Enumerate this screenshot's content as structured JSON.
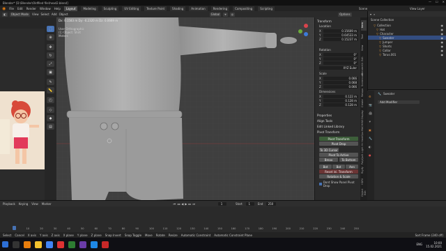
{
  "titlebar": {
    "title": "Blender* [D:\\Blender\\Oldfiled file\\head2.blend]"
  },
  "menu": {
    "items": [
      "File",
      "Edit",
      "Render",
      "Window",
      "Help"
    ]
  },
  "workspaces": {
    "tabs": [
      "Layout",
      "Modeling",
      "Sculpting",
      "UV Editing",
      "Texture Paint",
      "Shading",
      "Animation",
      "Rendering",
      "Compositing",
      "Scripting"
    ],
    "active": "Layout"
  },
  "scene": {
    "scene_label": "Scene",
    "view_layer_label": "View Layer"
  },
  "viewport_header": {
    "mode": "Object Mode",
    "view": "View",
    "select": "Select",
    "add": "Add",
    "object": "Object",
    "orientation": "Global",
    "options": "Options"
  },
  "viewport": {
    "stats": "Dx: 0.1583 m  Dy: -0.2320 m  Dz: 0.0669 m",
    "mode_line1": "User Orthographic",
    "mode_line2": "(1) Object: Shirt",
    "mode_line3": "Meters"
  },
  "npanel": {
    "transform": "Transform",
    "location": "Location",
    "loc": [
      {
        "axis": "X",
        "val": "0.15609 m"
      },
      {
        "axis": "Y",
        "val": "0.64533 m"
      },
      {
        "axis": "Z",
        "val": "0.15237 m"
      }
    ],
    "rotation": "Rotation",
    "rot": [
      {
        "axis": "X",
        "val": "0°"
      },
      {
        "axis": "Y",
        "val": "0°"
      },
      {
        "axis": "Z",
        "val": "0°"
      }
    ],
    "rot_mode": "XYZ Euler",
    "scale": "Scale",
    "scl": [
      {
        "axis": "X",
        "val": "0.066"
      },
      {
        "axis": "Y",
        "val": "0.068"
      },
      {
        "axis": "Z",
        "val": "0.066"
      }
    ],
    "dimensions": "Dimensions",
    "dim": [
      {
        "axis": "X",
        "val": "0.122 m"
      },
      {
        "axis": "Y",
        "val": "0.128 m"
      },
      {
        "axis": "Z",
        "val": "0.128 m"
      }
    ],
    "properties": "Properties",
    "align_tools": "Align Tools",
    "edit_linked": "Edit Linked Library",
    "pivot_transform": "Pivot Transform",
    "pivot_btns": [
      "Pivot Transform",
      "Pivot Drop",
      "To 3D Cursor",
      "Pivot To Active",
      "Bmax",
      "To Bottom"
    ],
    "tabs3": [
      "Bot",
      "Bot",
      "Ann"
    ],
    "reset": "Reset ini. Transform",
    "rotation_scale": "Rotation & Scale",
    "dont_show": "Dont Show Panel Pivot Drop",
    "tabs": [
      "Item",
      "Tool",
      "View",
      "Edit",
      "BlenderKit",
      "Screencast",
      "Retopo",
      "Create",
      "Display",
      "MACHIN3",
      "HardOps",
      "Light Hr",
      "PolyQuilt",
      "Rigify",
      "HDRI",
      "Object Edit"
    ]
  },
  "outliner": {
    "root": "Scene Collection",
    "items": [
      {
        "name": "Collection",
        "indent": 1
      },
      {
        "name": "Hat",
        "indent": 2
      },
      {
        "name": "Character",
        "indent": 2
      },
      {
        "name": "Sweater",
        "indent": 3
      },
      {
        "name": "Jumper",
        "indent": 3
      },
      {
        "name": "Shorts",
        "indent": 3
      },
      {
        "name": "Collar",
        "indent": 3
      },
      {
        "name": "Torus.001",
        "indent": 3
      }
    ]
  },
  "props": {
    "object_name": "Sweater",
    "modifier": "Add Modifier"
  },
  "timeline": {
    "menu": [
      "Playback",
      "Keying",
      "View",
      "Marker"
    ],
    "ticks": [
      "0",
      "10",
      "20",
      "30",
      "40",
      "50",
      "60",
      "70",
      "80",
      "90",
      "100",
      "110",
      "120",
      "130",
      "140",
      "150",
      "160",
      "170",
      "180",
      "190",
      "200",
      "210",
      "220",
      "230",
      "240",
      "250"
    ],
    "current_frame": "1",
    "start_label": "Start",
    "start": "1",
    "end_label": "End",
    "end": "250"
  },
  "statusbar": {
    "items": [
      "Select",
      "Cancel",
      "X axis",
      "Y axis",
      "Z axis",
      "X plane",
      "Y plane",
      "Z plane",
      "Snap Invert",
      "Snap Toggle",
      "Move",
      "Rotate",
      "Resize",
      "Automatic Constraint",
      "Automatic Constraint Plane"
    ],
    "right": "Sort Frame (240 off)"
  },
  "taskbar": {
    "time": "10:00",
    "date": "15.02.2021",
    "lang": "ENG"
  }
}
